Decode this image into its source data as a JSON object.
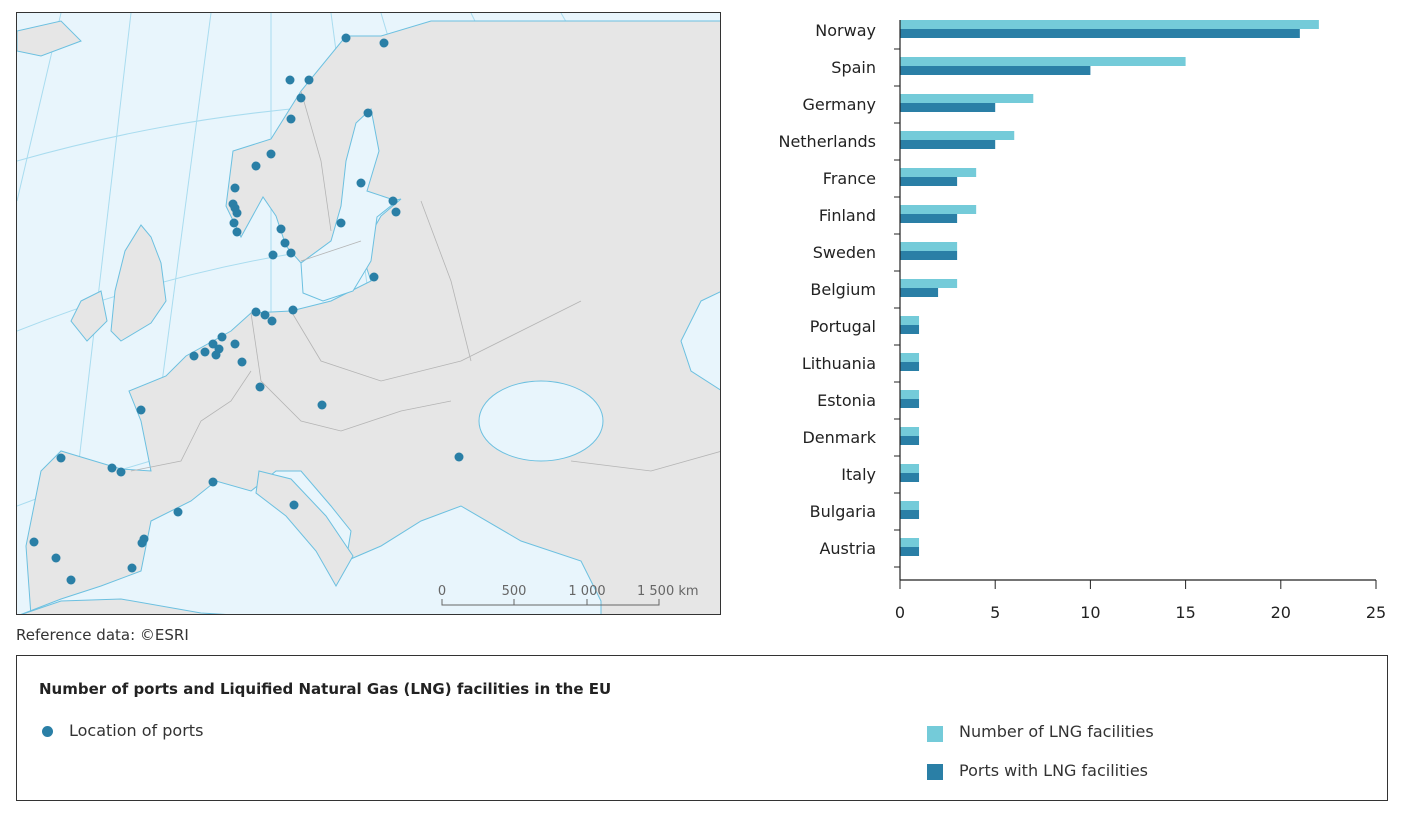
{
  "map": {
    "reference": "Reference data: ©ESRI",
    "scale_labels": [
      "0",
      "500",
      "1 000",
      "1 500 km"
    ],
    "colors": {
      "sea": "#e8f5fc",
      "land": "#e6e6e6",
      "border": "#b4b4b4",
      "coast": "#6cc0e0",
      "port": "#2a7fa6"
    }
  },
  "legend": {
    "title": "Number of ports and Liquified Natural Gas (LNG) facilities in the EU",
    "ports": "Location of ports",
    "series_a": "Number of LNG facilities",
    "series_b": "Ports with LNG facilities"
  },
  "chart_data": {
    "type": "bar",
    "orientation": "horizontal",
    "categories": [
      "Norway",
      "Spain",
      "Germany",
      "Netherlands",
      "France",
      "Finland",
      "Sweden",
      "Belgium",
      "Portugal",
      "Lithuania",
      "Estonia",
      "Denmark",
      "Italy",
      "Bulgaria",
      "Austria"
    ],
    "series": [
      {
        "name": "Number of LNG facilities",
        "color": "#74cbd9",
        "values": [
          22,
          15,
          7,
          6,
          4,
          4,
          3,
          3,
          1,
          1,
          1,
          1,
          1,
          1,
          1
        ]
      },
      {
        "name": "Ports with LNG facilities",
        "color": "#2a7fa6",
        "values": [
          21,
          10,
          5,
          5,
          3,
          3,
          3,
          2,
          1,
          1,
          1,
          1,
          1,
          1,
          1
        ]
      }
    ],
    "xlim": [
      0,
      25
    ],
    "xticks": [
      "0",
      "5",
      "10",
      "15",
      "20",
      "25"
    ],
    "grid": false,
    "legend_position": "bottom"
  }
}
